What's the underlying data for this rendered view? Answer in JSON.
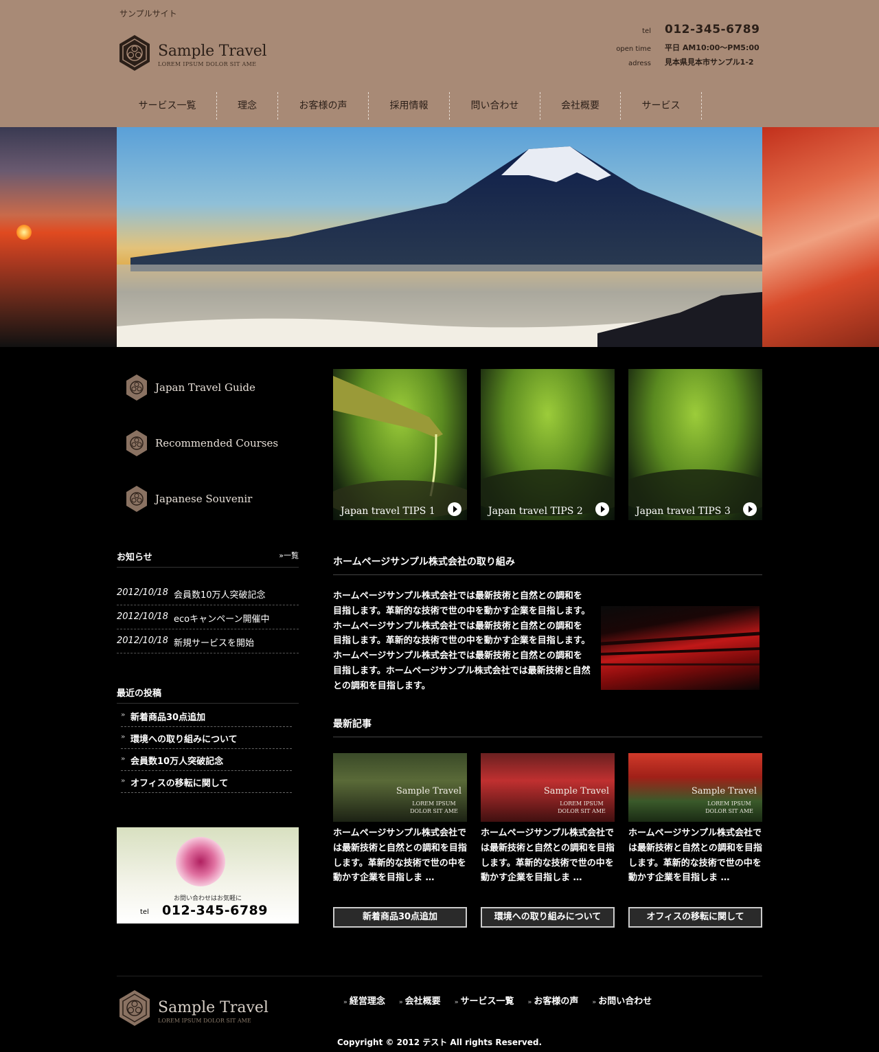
{
  "header": {
    "site_tag": "サンプルサイト",
    "logo_name": "Sample Travel",
    "logo_sub": "LOREM IPSUM DOLOR SIT AME",
    "contact": {
      "tel_label": "tel",
      "tel_value": "012-345-6789",
      "time_label": "open time",
      "time_value": "平日 AM10:00〜PM5:00",
      "addr_label": "adress",
      "addr_value": "見本県見本市サンプル1-2"
    }
  },
  "nav": [
    "サービス一覧",
    "理念",
    "お客様の声",
    "採用情報",
    "問い合わせ",
    "会社概要",
    "サービス"
  ],
  "side_menu": [
    "Japan Travel Guide",
    "Recommended Courses",
    "Japanese Souvenir"
  ],
  "tips": [
    "Japan travel TIPS 1",
    "Japan travel TIPS 2",
    "Japan travel TIPS 3"
  ],
  "news": {
    "title": "お知らせ",
    "more": "»一覧",
    "items": [
      {
        "date": "2012/10/18",
        "text": "会員数10万人突破記念"
      },
      {
        "date": "2012/10/18",
        "text": "ecoキャンペーン開催中"
      },
      {
        "date": "2012/10/18",
        "text": "新規サービスを開始"
      }
    ]
  },
  "recent_posts": {
    "title": "最近の投稿",
    "bullet": "»",
    "items": [
      "新着商品30点追加",
      "環境への取り組みについて",
      "会員数10万人突破記念",
      "オフィスの移転に関して"
    ]
  },
  "contact_banner": {
    "note": "お問い合わせはお気軽に",
    "tel_label": "tel",
    "tel_value": "012-345-6789"
  },
  "intro": {
    "title": "ホームページサンプル株式会社の取り組み",
    "text": "ホームページサンプル株式会社では最新技術と自然との調和を目指します。革新的な技術で世の中を動かす企業を目指します。ホームページサンプル株式会社では最新技術と自然との調和を目指します。革新的な技術で世の中を動かす企業を目指します。ホームページサンプル株式会社では最新技術と自然との調和を目指します。ホームページサンプル株式会社では最新技術と自然との調和を目指します。"
  },
  "latest": {
    "title": "最新記事",
    "brand": "Sample Travel",
    "brand_sub": "LOREM IPSUM DOLOR SIT AME",
    "articles": [
      {
        "text": "ホームページサンプル株式会社では最新技術と自然との調和を目指します。革新的な技術で世の中を動かす企業を目指しま …",
        "button": "新着商品30点追加"
      },
      {
        "text": "ホームページサンプル株式会社では最新技術と自然との調和を目指します。革新的な技術で世の中を動かす企業を目指しま …",
        "button": "環境への取り組みについて"
      },
      {
        "text": "ホームページサンプル株式会社では最新技術と自然との調和を目指します。革新的な技術で世の中を動かす企業を目指しま …",
        "button": "オフィスの移転に関して"
      }
    ]
  },
  "footer": {
    "logo_name": "Sample Travel",
    "logo_sub": "LOREM IPSUM DOLOR SIT AME",
    "bullet": "»",
    "links": [
      "経営理念",
      "会社概要",
      "サービス一覧",
      "お客様の声",
      "お問い合わせ"
    ],
    "copyright": "Copyright © 2012 テスト All rights Reserved."
  },
  "colors": {
    "header_bg": "#a88a76",
    "page_bg": "#000000",
    "accent_text": "#2b1f18"
  }
}
